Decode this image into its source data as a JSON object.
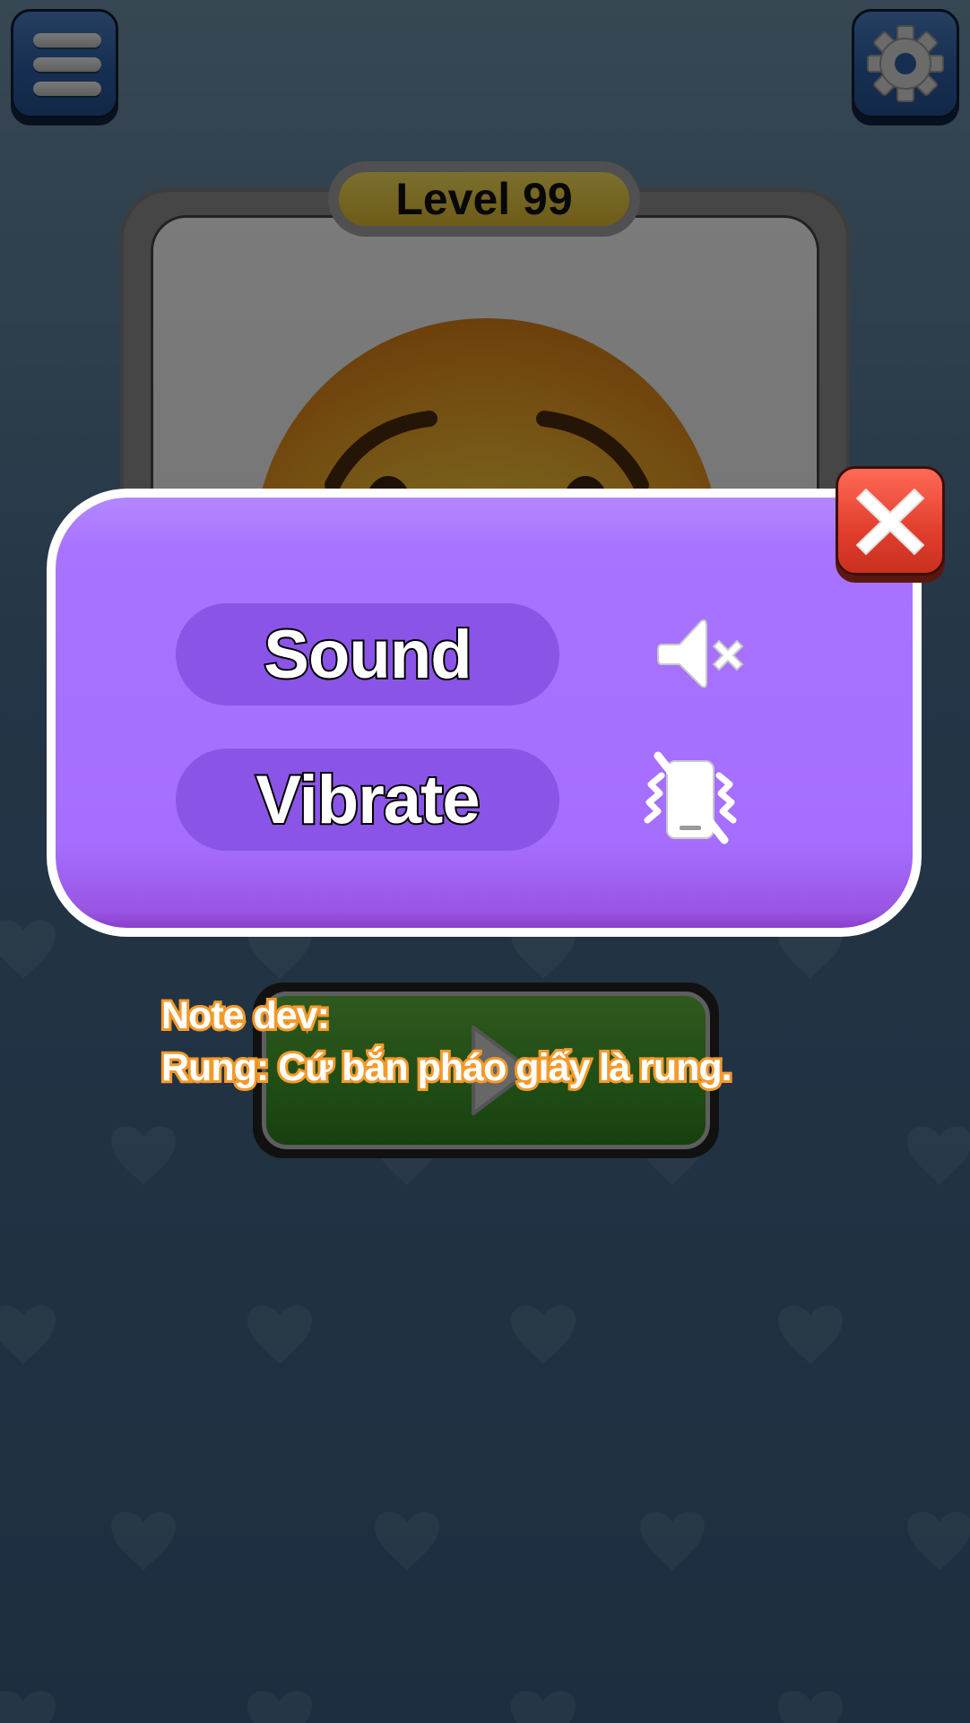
{
  "header": {
    "menu_icon": "hamburger-menu-icon",
    "settings_icon": "gear-icon"
  },
  "level": {
    "label": "Level 99"
  },
  "puzzle": {
    "image": "worried-face-emoji"
  },
  "play": {
    "icon": "play-icon"
  },
  "settings_panel": {
    "sound_label": "Sound",
    "sound_icon": "speaker-muted-icon",
    "sound_enabled": false,
    "vibrate_label": "Vibrate",
    "vibrate_icon": "vibrate-off-icon",
    "vibrate_enabled": false,
    "close_icon": "close-icon"
  },
  "note": {
    "line1": "Note dev:",
    "line2": "Rung: Cứ bắn pháo giấy là rung."
  },
  "colors": {
    "panel_purple": "#a56eff",
    "row_purple": "#8a55e6",
    "close_red": "#e23e2d",
    "note_orange": "#f39a2b",
    "level_yellow": "#dcb730",
    "button_blue": "#2c5ea3",
    "play_green": "#3f9a2b"
  }
}
